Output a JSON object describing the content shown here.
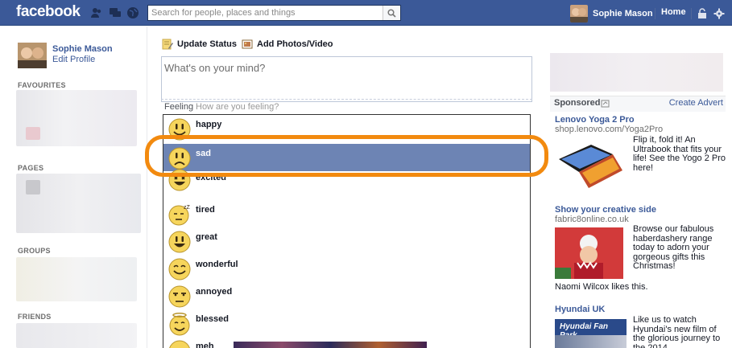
{
  "topbar": {
    "logo": "facebook",
    "search_placeholder": "Search for people, places and things",
    "user_name": "Sophie Mason",
    "home_label": "Home"
  },
  "leftnav": {
    "user_name": "Sophie Mason",
    "edit_profile": "Edit Profile",
    "headings": [
      "FAVOURITES",
      "PAGES",
      "GROUPS",
      "FRIENDS"
    ]
  },
  "composer": {
    "tabs": [
      {
        "label": "Update Status",
        "icon": "status-icon"
      },
      {
        "label": "Add Photos/Video",
        "icon": "photo-icon"
      }
    ],
    "placeholder": "What's on your mind?",
    "feeling_label": "Feeling",
    "feeling_placeholder": "How are you feeling?"
  },
  "feelings": {
    "selected": "sad",
    "options": [
      {
        "label": "happy",
        "icon": "happy-emoji-icon"
      },
      {
        "label": "sad",
        "icon": "sad-emoji-icon"
      },
      {
        "label": "excited",
        "icon": "excited-emoji-icon"
      },
      {
        "label": "tired",
        "icon": "tired-emoji-icon"
      },
      {
        "label": "great",
        "icon": "great-emoji-icon"
      },
      {
        "label": "wonderful",
        "icon": "wonderful-emoji-icon"
      },
      {
        "label": "annoyed",
        "icon": "annoyed-emoji-icon"
      },
      {
        "label": "blessed",
        "icon": "blessed-emoji-icon"
      },
      {
        "label": "meh",
        "icon": "meh-emoji-icon"
      }
    ]
  },
  "sponsored": {
    "label": "Sponsored",
    "create_advert": "Create Advert",
    "ads": [
      {
        "title": "Lenovo Yoga 2 Pro",
        "url": "shop.lenovo.com/Yoga2Pro",
        "text": "Flip it, fold it! An Ultrabook that fits your life! See the Yogo 2 Pro here!"
      },
      {
        "title": "Show your creative side",
        "url": "fabric8online.co.uk",
        "text": "Browse our fabulous haberdashery range today to adorn your gorgeous gifts this Christmas!",
        "social": "Naomi Wilcox likes this."
      },
      {
        "title": "Hyundai UK",
        "image_text": "Hyundai Fan Park",
        "text": "Like us to watch Hyundai's new film of the glorious journey to the 2014"
      }
    ]
  },
  "colors": {
    "brand_blue": "#3b5998",
    "selected_row": "#6d84b4",
    "annotation_orange": "#f28a0f"
  }
}
